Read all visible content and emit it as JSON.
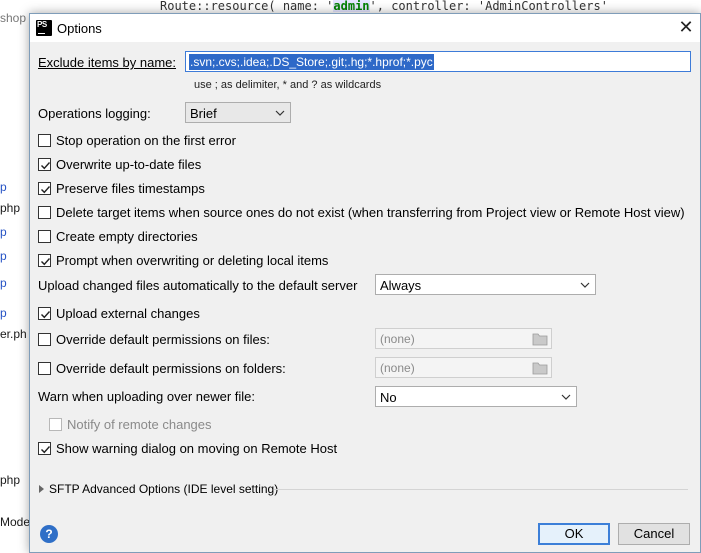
{
  "ide": {
    "editor_snippet_pre": "Route::resource( name: '",
    "editor_snippet_kw": "admin",
    "editor_snippet_post": "', controller: 'AdminControllers'",
    "sidebar_files": [
      {
        "text": "shop",
        "color": "gray"
      },
      {
        "text": "p",
        "color": "blue"
      },
      {
        "text": "php",
        "color": "normal"
      },
      {
        "text": "p",
        "color": "blue"
      },
      {
        "text": "p",
        "color": "blue"
      },
      {
        "text": "p",
        "color": "blue"
      },
      {
        "text": "p",
        "color": "blue"
      },
      {
        "text": "er.ph",
        "color": "normal"
      },
      {
        "text": "php",
        "color": "normal"
      },
      {
        "text": "Mode",
        "color": "normal"
      }
    ]
  },
  "dialog": {
    "title": "Options",
    "close_glyph": "✕",
    "exclude": {
      "label": "Exclude items by name:",
      "value": ".svn;.cvs;.idea;.DS_Store;.git;.hg;*.hprof;*.pyc",
      "hint": "use ; as delimiter, * and ? as wildcards"
    },
    "operations_logging": {
      "label": "Operations logging:",
      "value": "Brief"
    },
    "checks": {
      "stop_on_error": {
        "label": "Stop operation on the first error",
        "checked": false
      },
      "overwrite": {
        "label": "Overwrite up-to-date files",
        "checked": true
      },
      "preserve_timestamps": {
        "label": "Preserve files timestamps",
        "checked": true
      },
      "delete_target": {
        "label": "Delete target items when source ones do not exist (when transferring from Project view or Remote Host view)",
        "checked": false
      },
      "create_empty_dirs": {
        "label": "Create empty directories",
        "checked": false
      },
      "prompt_overwrite": {
        "label": "Prompt when overwriting or deleting local items",
        "checked": true
      },
      "upload_external": {
        "label": "Upload external changes",
        "checked": true
      },
      "override_files": {
        "label": "Override default permissions on files:",
        "checked": false
      },
      "override_folders": {
        "label": "Override default permissions on folders:",
        "checked": false
      },
      "notify_remote": {
        "label": "Notify of remote changes",
        "checked": false
      },
      "show_warning": {
        "label": "Show warning dialog on moving on Remote Host",
        "checked": true
      }
    },
    "upload_changed": {
      "label": "Upload changed files automatically to the default server",
      "value": "Always"
    },
    "perm_files_value": "(none)",
    "perm_folders_value": "(none)",
    "warn_newer": {
      "label": "Warn when uploading over newer file:",
      "value": "No"
    },
    "sftp_section": "SFTP Advanced Options (IDE level setting)",
    "help_glyph": "?",
    "ok_label": "OK",
    "cancel_label": "Cancel"
  }
}
